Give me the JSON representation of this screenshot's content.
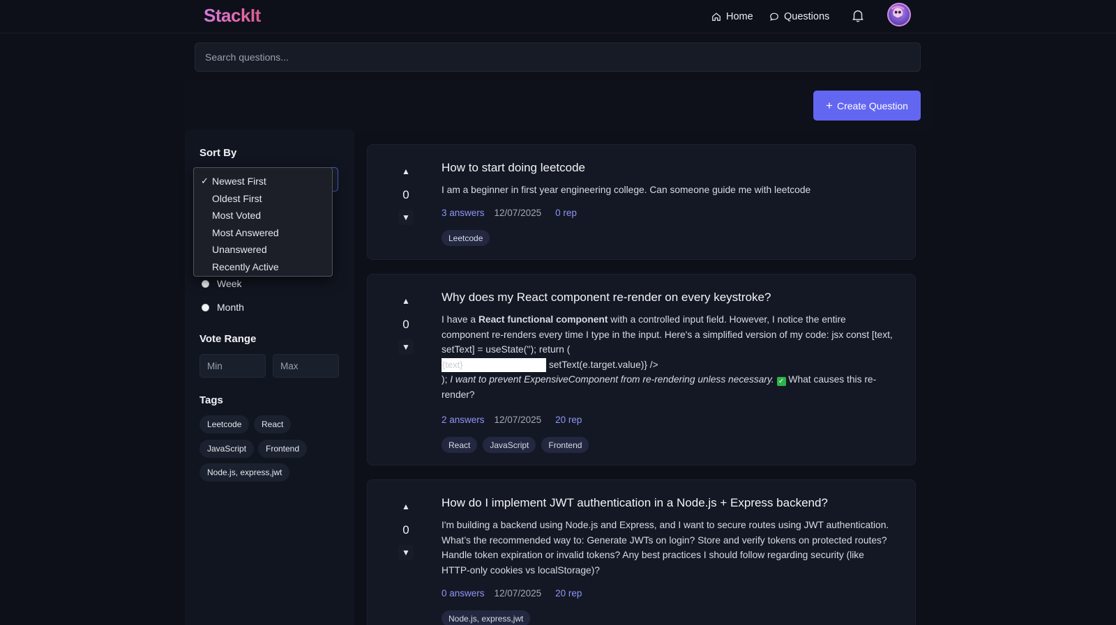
{
  "app": {
    "logo": "StackIt"
  },
  "nav": {
    "home": "Home",
    "questions": "Questions"
  },
  "search": {
    "placeholder": "Search questions..."
  },
  "toolbar": {
    "create_label": "Create Question"
  },
  "sidebar": {
    "sort_title": "Sort By",
    "sort_options": [
      "Newest First",
      "Oldest First",
      "Most Voted",
      "Most Answered",
      "Unanswered",
      "Recently Active"
    ],
    "sort_selected": "Newest First",
    "time_options": [
      "Week",
      "Month"
    ],
    "vote_range_title": "Vote Range",
    "vote_min_placeholder": "Min",
    "vote_max_placeholder": "Max",
    "tags_title": "Tags",
    "tags": [
      "Leetcode",
      "React",
      "JavaScript",
      "Frontend",
      "Node.js, express,jwt"
    ]
  },
  "questions": [
    {
      "votes": "0",
      "title": "How to start doing leetcode",
      "body": "I am a beginner in first year engineering college. Can someone guide me with leetcode",
      "answers": "3 answers",
      "date": "12/07/2025",
      "rep": "0 rep",
      "tags": [
        "Leetcode"
      ]
    },
    {
      "votes": "0",
      "title": "Why does my React component re-render on every keystroke?",
      "body_parts": {
        "p1": "I have a ",
        "bold": "React functional component",
        "p2": " with a controlled input field. However, I notice the entire component re-renders every time I type in the input. Here's a simplified version of my code: jsx const [text, setText] = useState(''); return (",
        "code_value": "{text}",
        "p3": " setText(e.target.value)} />",
        "p4": "); ",
        "italic": "I want to prevent ExpensiveComponent from re-rendering unless necessary.",
        "p5": " What causes this re-render?"
      },
      "answers": "2 answers",
      "date": "12/07/2025",
      "rep": "20 rep",
      "tags": [
        "React",
        "JavaScript",
        "Frontend"
      ]
    },
    {
      "votes": "0",
      "title": "How do I implement JWT authentication in a Node.js + Express backend?",
      "body": "I'm building a backend using Node.js and Express, and I want to secure routes using JWT authentication. What’s the recommended way to: Generate JWTs on login? Store and verify tokens on protected routes? Handle token expiration or invalid tokens? Any best practices I should follow regarding security (like HTTP-only cookies vs localStorage)?",
      "answers": "0 answers",
      "date": "12/07/2025",
      "rep": "20 rep",
      "tags": [
        "Node.js, express,jwt"
      ]
    }
  ],
  "colors": {
    "accent": "#6366f1",
    "background": "#0d1018",
    "card": "#141824",
    "link": "#8e96f5"
  },
  "icons": {
    "home": "home-icon",
    "questions": "chat-bubble-icon",
    "notifications": "bell-icon",
    "check": "checkmark-icon",
    "up": "arrow-up-icon",
    "down": "arrow-down-icon"
  }
}
